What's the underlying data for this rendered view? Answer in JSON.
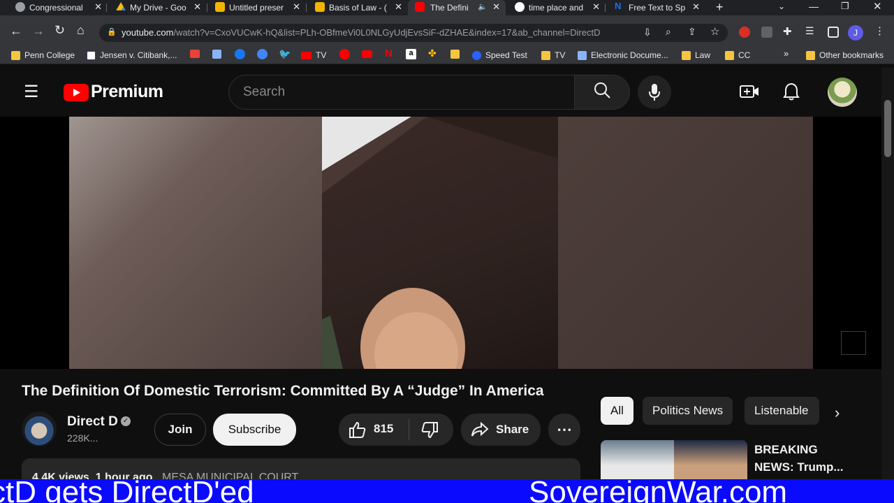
{
  "browser": {
    "tabs": [
      {
        "title": "Congressional",
        "color": "#9aa0a6"
      },
      {
        "title": "My Drive - Goo",
        "color": "#34a853"
      },
      {
        "title": "Untitled preser",
        "color": "#f4b400"
      },
      {
        "title": "Basis of Law - (",
        "color": "#f4b400"
      },
      {
        "title": "The Defini",
        "color": "#ff0000"
      },
      {
        "title": "time place and",
        "color": "#ffffff"
      },
      {
        "title": "Free Text to Sp",
        "color": "#1a73e8"
      }
    ],
    "new_tab_label": "+",
    "url_host": "youtube.com",
    "url_path": "/watch?v=CxoVUCwK-hQ&list=PLh-OBfmeVi0L0NLGyUdjEvsSiF-dZHAE&index=17&ab_channel=DirectD",
    "profile_initial": "J",
    "bookmarks": [
      {
        "label": "Penn College",
        "kind": "folder"
      },
      {
        "label": "Jensen v. Citibank,...",
        "kind": "page"
      },
      {
        "label": "TV",
        "kind": "youtube"
      },
      {
        "label": "Speed Test",
        "kind": "page"
      },
      {
        "label": "TV",
        "kind": "folder"
      },
      {
        "label": "Electronic Docume...",
        "kind": "page"
      },
      {
        "label": "Law",
        "kind": "folder"
      },
      {
        "label": "CC",
        "kind": "folder"
      }
    ],
    "more_bookmarks": "»",
    "other_bookmarks": "Other bookmarks"
  },
  "youtube": {
    "logo_text": "Premium",
    "search_placeholder": "Search",
    "video_title": "The Definition Of Domestic Terrorism: Committed By A “Judge” In America",
    "channel_name": "Direct D",
    "subscribers": "228K...",
    "join_label": "Join",
    "subscribe_label": "Subscribe",
    "likes": "815",
    "share_label": "Share",
    "views_line": "4.4K views  1 hour ago",
    "description_tag": "MESA MUNICIPAL COURT",
    "chips": [
      "All",
      "Politics News",
      "Listenable"
    ],
    "suggested_title_1": "BREAKING",
    "suggested_title_2": "NEWS: Trump..."
  },
  "ticker": {
    "left_text": "ctD gets DirectD'ed",
    "right_text": "SovereignWar.com"
  }
}
